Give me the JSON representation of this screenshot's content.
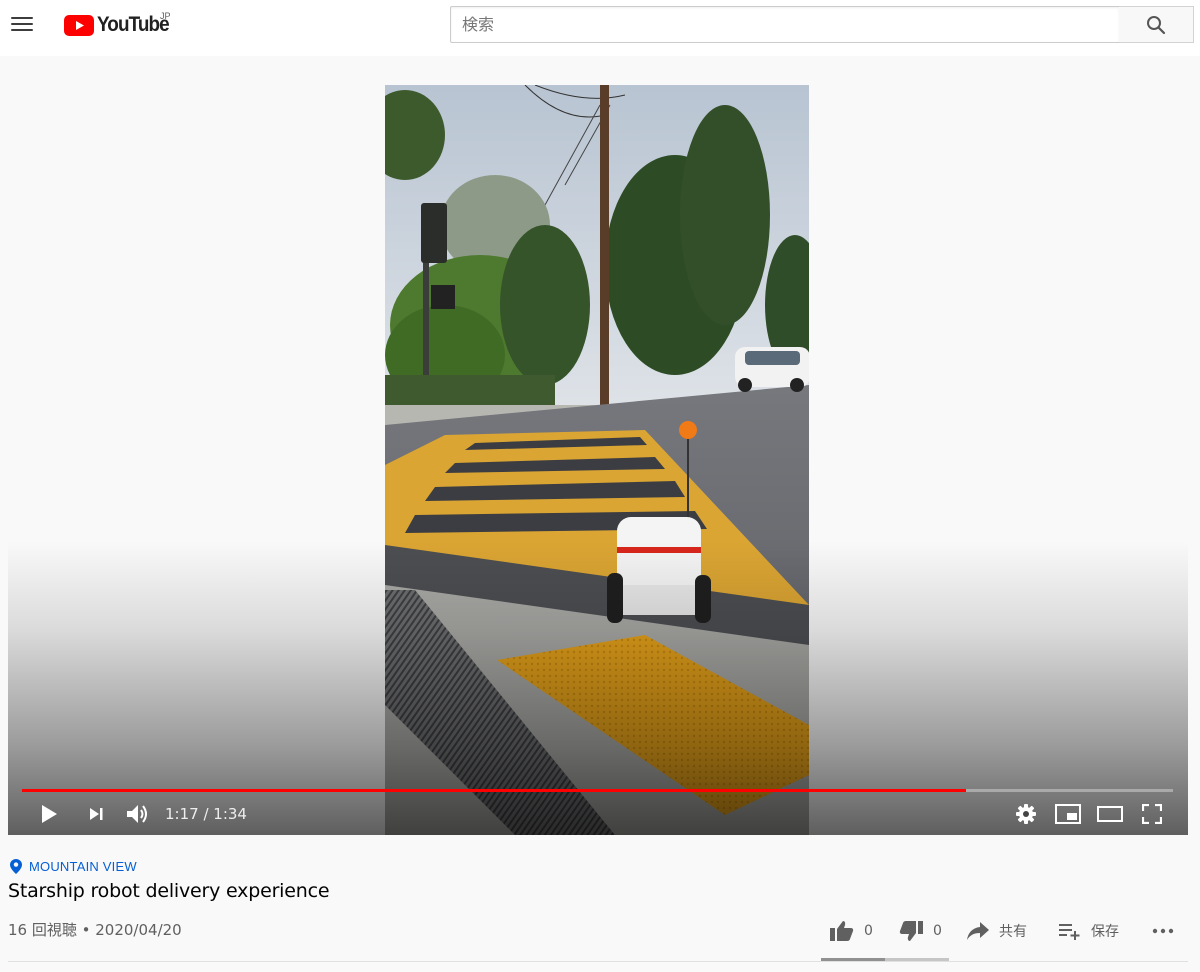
{
  "masthead": {
    "logo_text": "YouTube",
    "country_code": "JP",
    "search_placeholder": "検索",
    "search_value": ""
  },
  "player": {
    "current_time": "1:17",
    "time_separator": " / ",
    "duration": "1:34",
    "progress_played": 0.82,
    "progress_loaded": 0.82,
    "progress_color": "#ff0000",
    "icons": {
      "play": "play-icon",
      "next": "next-icon",
      "volume": "volume-icon",
      "settings": "gear-icon",
      "miniplayer": "miniplayer-icon",
      "theater": "theater-mode-icon",
      "fullscreen": "fullscreen-icon"
    }
  },
  "video": {
    "location": "MOUNTAIN VIEW",
    "title": "Starship robot delivery experience",
    "views": "16 回視聴",
    "separator": " • ",
    "date": "2020/04/20",
    "likes": "0",
    "dislikes": "0",
    "share_label": "共有",
    "save_label": "保存",
    "like_ratio": 0.5
  },
  "colors": {
    "link_blue": "#065fd4",
    "youtube_red": "#ff0000"
  }
}
